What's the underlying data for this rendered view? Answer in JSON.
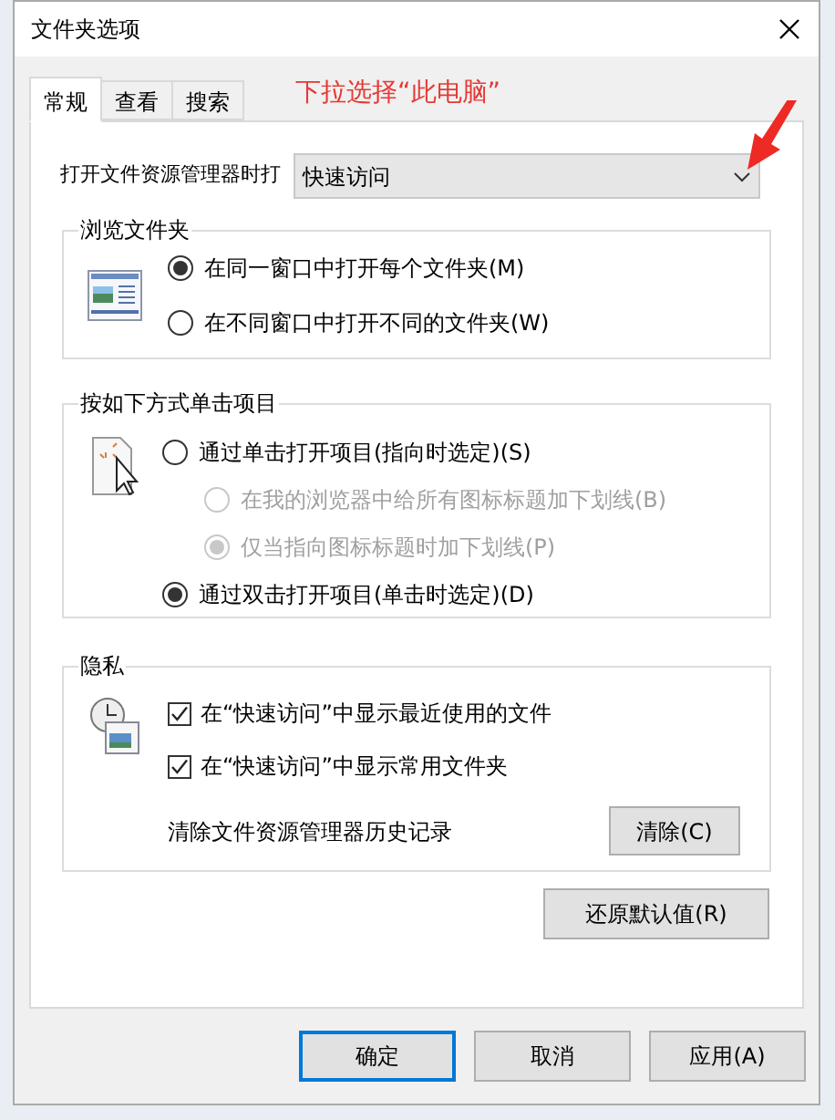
{
  "window": {
    "title": "文件夹选项"
  },
  "tabs": [
    {
      "label": "常规",
      "selected": true
    },
    {
      "label": "查看",
      "selected": false
    },
    {
      "label": "搜索",
      "selected": false
    }
  ],
  "annotation": {
    "text": "下拉选择“此电脑”"
  },
  "open_explorer": {
    "label": "打开文件资源管理器时打",
    "value": "快速访问"
  },
  "browse_group": {
    "title": "浏览文件夹",
    "options": [
      {
        "label": "在同一窗口中打开每个文件夹(M)",
        "selected": true
      },
      {
        "label": "在不同窗口中打开不同的文件夹(W)",
        "selected": false
      }
    ]
  },
  "click_group": {
    "title": "按如下方式单击项目",
    "options": [
      {
        "label": "通过单击打开项目(指向时选定)(S)",
        "selected": false,
        "disabled": false,
        "children": [
          {
            "label": "在我的浏览器中给所有图标标题加下划线(B)",
            "selected": false,
            "disabled": true
          },
          {
            "label": "仅当指向图标标题时加下划线(P)",
            "selected": true,
            "disabled": true
          }
        ]
      },
      {
        "label": "通过双击打开项目(单击时选定)(D)",
        "selected": true,
        "disabled": false
      }
    ]
  },
  "privacy_group": {
    "title": "隐私",
    "checkboxes": [
      {
        "label": "在“快速访问”中显示最近使用的文件",
        "checked": true
      },
      {
        "label": "在“快速访问”中显示常用文件夹",
        "checked": true
      }
    ],
    "clear_label": "清除文件资源管理器历史记录",
    "clear_button": "清除(C)"
  },
  "restore_button": "还原默认值(R)",
  "buttons": [
    {
      "label": "确定",
      "selected": true
    },
    {
      "label": "取消",
      "selected": false
    },
    {
      "label": "应用(A)",
      "selected": false
    }
  ]
}
